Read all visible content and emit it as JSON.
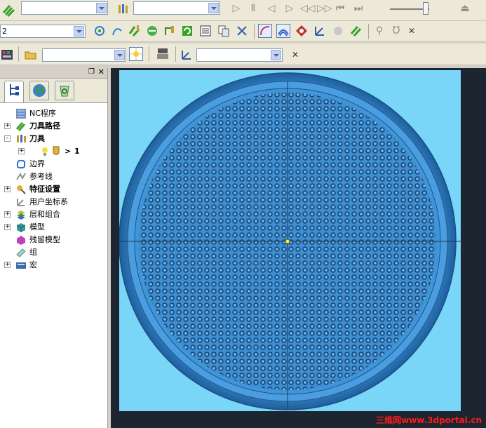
{
  "toolbar_top": {
    "combo_1_value": "",
    "combo_2_value": ""
  },
  "toolbar_mid": {
    "combo_value": "2"
  },
  "toolbar_low": {
    "combo_1_value": "",
    "combo_2_value": ""
  },
  "explorer": {
    "items": [
      {
        "label": "NC程序",
        "bold": false,
        "expand": ""
      },
      {
        "label": "刀具路径",
        "bold": true,
        "expand": "+"
      },
      {
        "label": "刀具",
        "bold": true,
        "expand": "-"
      },
      {
        "label": "1",
        "bold": false,
        "expand": "+"
      },
      {
        "label": "边界",
        "bold": false,
        "expand": ""
      },
      {
        "label": "参考线",
        "bold": false,
        "expand": ""
      },
      {
        "label": "特征设置",
        "bold": true,
        "expand": "+"
      },
      {
        "label": "用户坐标系",
        "bold": false,
        "expand": ""
      },
      {
        "label": "层和组合",
        "bold": false,
        "expand": "+"
      },
      {
        "label": "模型",
        "bold": false,
        "expand": "+"
      },
      {
        "label": "残留模型",
        "bold": false,
        "expand": ""
      },
      {
        "label": "组",
        "bold": false,
        "expand": ""
      },
      {
        "label": "宏",
        "bold": false,
        "expand": "+"
      }
    ]
  },
  "watermark": "三维网www.3dportal.cn",
  "colors": {
    "background_blue": "#7ad6f8",
    "part_blue": "#3a8ed0"
  }
}
